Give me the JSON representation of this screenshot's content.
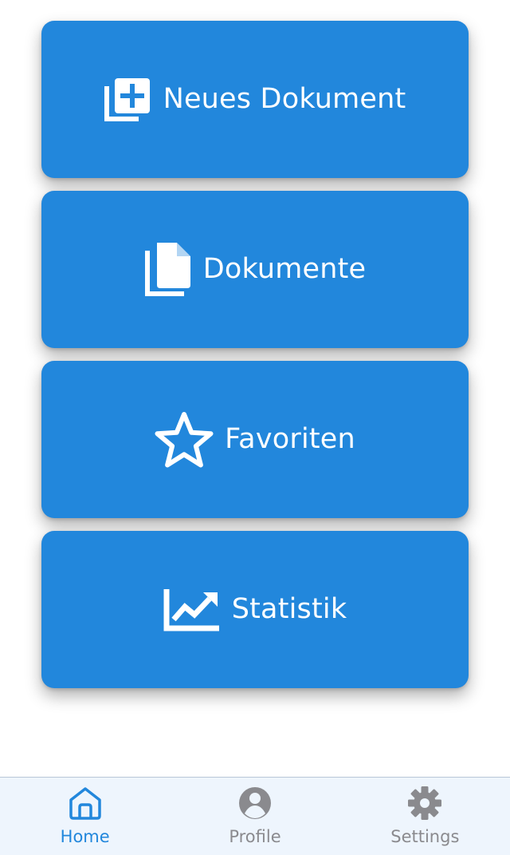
{
  "cards": [
    {
      "label": "Neues Dokument",
      "icon": "library-add-icon"
    },
    {
      "label": "Dokumente",
      "icon": "documents-icon"
    },
    {
      "label": "Favoriten",
      "icon": "star-icon"
    },
    {
      "label": "Statistik",
      "icon": "trending-chart-icon"
    }
  ],
  "tabbar": {
    "items": [
      {
        "label": "Home",
        "icon": "home-icon",
        "active": true
      },
      {
        "label": "Profile",
        "icon": "profile-icon",
        "active": false
      },
      {
        "label": "Settings",
        "icon": "gear-icon",
        "active": false
      }
    ]
  },
  "colors": {
    "card_background": "#2287dc",
    "tab_active": "#2287dc",
    "tab_inactive": "#8a8a8e",
    "tabbar_background": "#eef5fd"
  }
}
